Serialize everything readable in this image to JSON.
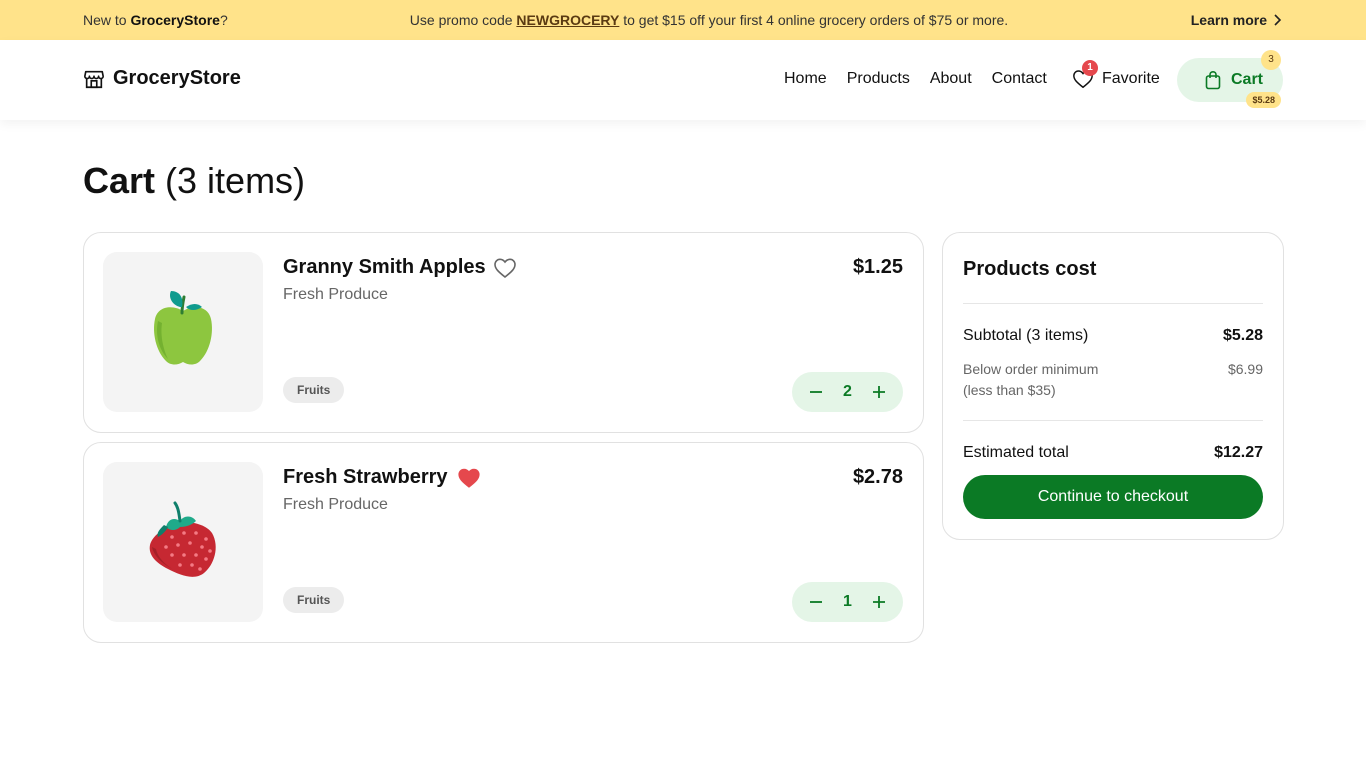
{
  "promo": {
    "new_to_prefix": "New to ",
    "brand": "GroceryStore",
    "new_to_suffix": "?",
    "message_prefix": "Use promo code ",
    "code": "NEWGROCERY",
    "message_suffix": " to get $15 off your first 4 online grocery orders of $75 or more.",
    "learn_more": "Learn more"
  },
  "header": {
    "logo_text": "GroceryStore",
    "nav": [
      "Home",
      "Products",
      "About",
      "Contact"
    ],
    "favorite_label": "Favorite",
    "favorite_badge": "1",
    "cart_label": "Cart",
    "cart_count": "3",
    "cart_amount": "$5.28"
  },
  "page": {
    "title_bold": "Cart",
    "title_rest": " (3 items)"
  },
  "items": [
    {
      "name": "Granny Smith Apples",
      "category": "Fresh Produce",
      "price": "$1.25",
      "tag": "Fruits",
      "quantity": "2",
      "favorited": false,
      "icon": "green-apple-icon"
    },
    {
      "name": "Fresh Strawberry",
      "category": "Fresh Produce",
      "price": "$2.78",
      "tag": "Fruits",
      "quantity": "1",
      "favorited": true,
      "icon": "strawberry-icon"
    }
  ],
  "summary": {
    "title": "Products cost",
    "subtotal_label": "Subtotal (3 items)",
    "subtotal_value": "$5.28",
    "minimum_label_line1": "Below order minimum",
    "minimum_label_line2": "(less than $35)",
    "minimum_value": "$6.99",
    "estimated_label": "Estimated total",
    "estimated_value": "$12.27",
    "checkout_label": "Continue to checkout"
  },
  "colors": {
    "promo_bg": "#ffe38a",
    "accent_green": "#0b7a25",
    "green_tint": "#e4f5e7",
    "badge_red": "#e5484d"
  }
}
